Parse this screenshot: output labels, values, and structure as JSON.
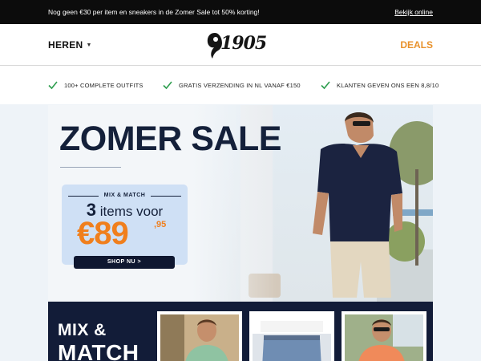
{
  "topbar": {
    "message": "Nog geen €30 per item en sneakers in de Zomer Sale tot 50% korting!",
    "link": "Bekijk online"
  },
  "header": {
    "nav_left": "HEREN",
    "logo_text": "1905",
    "nav_right": "DEALS"
  },
  "usp": [
    {
      "icon": "check-icon",
      "text": "100+ COMPLETE OUTFITS"
    },
    {
      "icon": "check-icon",
      "text": "GRATIS VERZENDING IN NL VANAF €150"
    },
    {
      "icon": "check-icon",
      "text": "KLANTEN GEVEN ONS EEN 8,8/10"
    }
  ],
  "hero": {
    "title": "ZOMER SALE",
    "promo": {
      "label": "MIX & MATCH",
      "count": "3",
      "count_text": "items voor",
      "price": "€89",
      "cents": ",95",
      "button": "SHOP NU >"
    }
  },
  "mix": {
    "title_line1": "MIX &",
    "title_line2": "MATCH"
  },
  "colors": {
    "accent": "#e8912a",
    "price": "#f07f1d",
    "navy": "#14203a",
    "topbar": "#0c0c0c"
  }
}
